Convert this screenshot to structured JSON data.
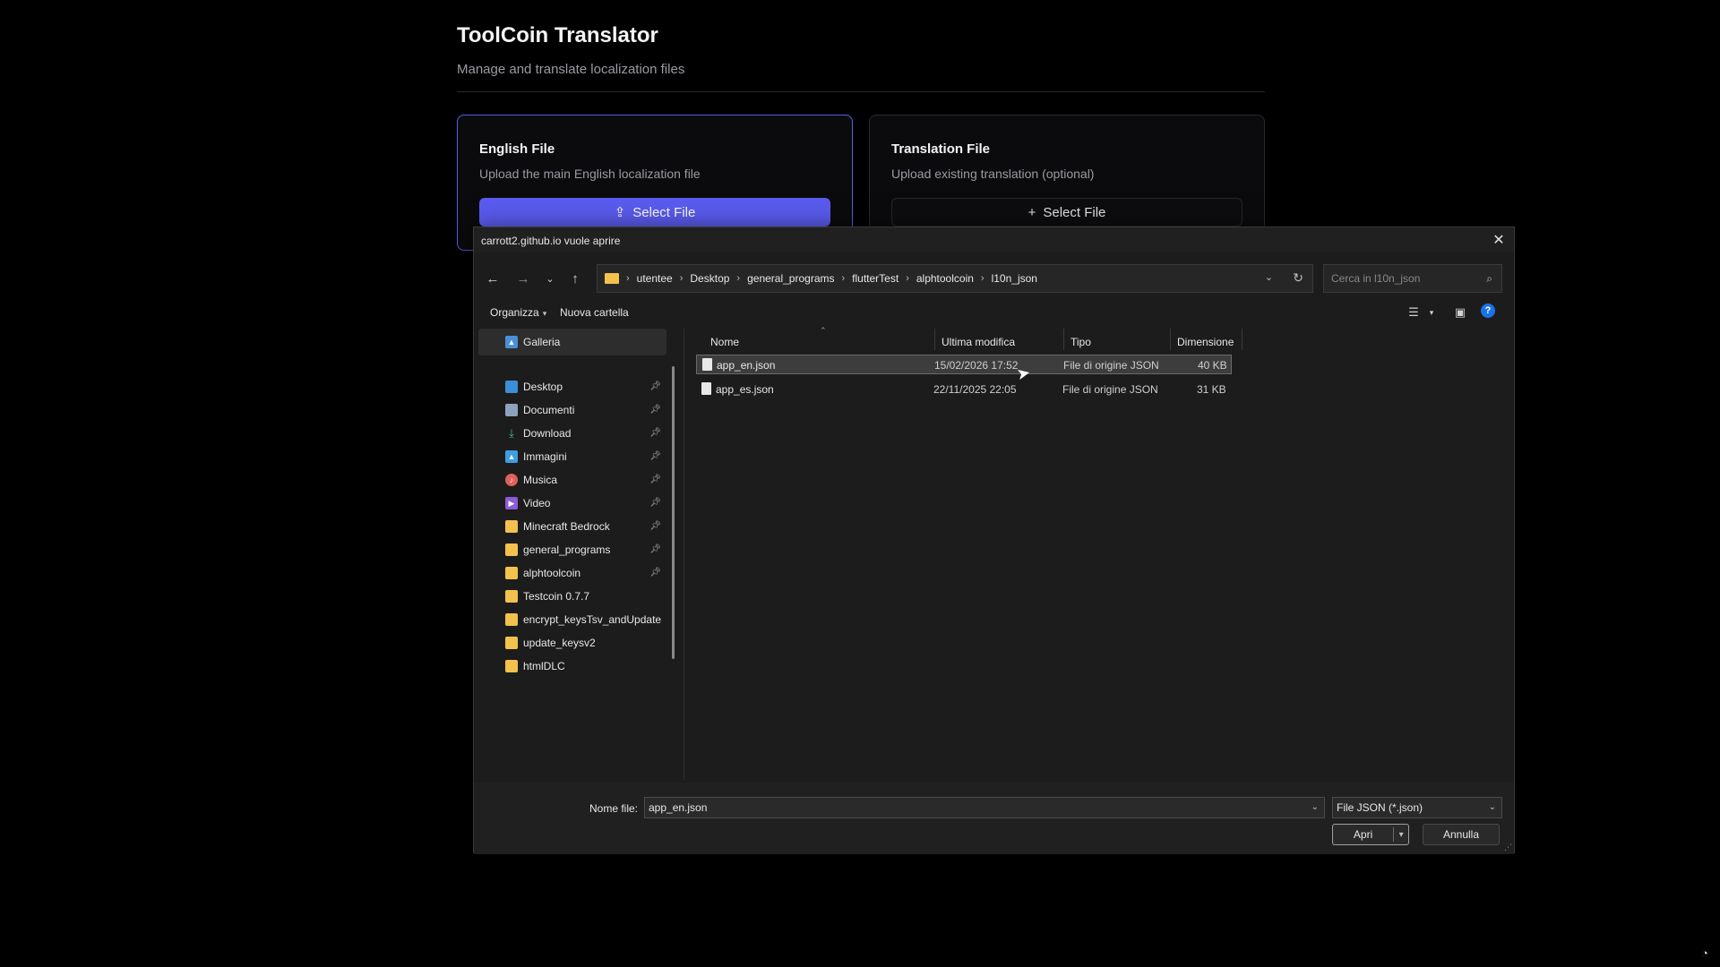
{
  "app": {
    "title": "ToolCoin Translator",
    "subtitle": "Manage and translate localization files",
    "english_card": {
      "title": "English File",
      "description": "Upload the main English localization file",
      "button_label": "Select File"
    },
    "translation_card": {
      "title": "Translation File",
      "description": "Upload existing translation (optional)",
      "button_label": "Select File"
    },
    "accent_color": "#5b5cf0"
  },
  "dialog": {
    "title": "carrott2.github.io vuole aprire",
    "breadcrumb": [
      "utentee",
      "Desktop",
      "general_programs",
      "flutterTest",
      "alphtoolcoin",
      "l10n_json"
    ],
    "search_placeholder": "Cerca in l10n_json",
    "commands": {
      "organize": "Organizza",
      "new_folder": "Nuova cartella"
    },
    "sidebar": {
      "gallery": "Galleria",
      "items": [
        {
          "label": "Desktop",
          "icon": "desktop-icon",
          "pinned": true
        },
        {
          "label": "Documenti",
          "icon": "documents-icon",
          "pinned": true
        },
        {
          "label": "Download",
          "icon": "download-icon",
          "pinned": true
        },
        {
          "label": "Immagini",
          "icon": "pictures-icon",
          "pinned": true
        },
        {
          "label": "Musica",
          "icon": "music-icon",
          "pinned": true
        },
        {
          "label": "Video",
          "icon": "video-icon",
          "pinned": true
        },
        {
          "label": "Minecraft Bedrock",
          "icon": "folder-icon",
          "pinned": true
        },
        {
          "label": "general_programs",
          "icon": "folder-icon",
          "pinned": true
        },
        {
          "label": "alphtoolcoin",
          "icon": "folder-icon",
          "pinned": true
        },
        {
          "label": "Testcoin 0.7.7",
          "icon": "folder-icon",
          "pinned": false
        },
        {
          "label": "encrypt_keysTsv_andUpdate",
          "icon": "folder-icon",
          "pinned": false
        },
        {
          "label": "update_keysv2",
          "icon": "folder-icon",
          "pinned": false
        },
        {
          "label": "htmlDLC",
          "icon": "folder-icon",
          "pinned": false
        }
      ]
    },
    "columns": {
      "name": "Nome",
      "modified": "Ultima modifica",
      "type": "Tipo",
      "size": "Dimensione"
    },
    "files": [
      {
        "name": "app_en.json",
        "modified": "15/02/2026 17:52",
        "type": "File di origine JSON",
        "size": "40 KB",
        "selected": true
      },
      {
        "name": "app_es.json",
        "modified": "22/11/2025 22:05",
        "type": "File di origine JSON",
        "size": "31 KB",
        "selected": false
      }
    ],
    "filename_label": "Nome file:",
    "filename_value": "app_en.json",
    "filetype": "File JSON (*.json)",
    "open_label": "Apri",
    "cancel_label": "Annulla"
  }
}
